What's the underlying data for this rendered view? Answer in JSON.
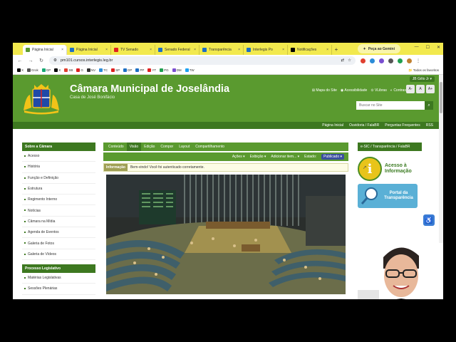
{
  "browser": {
    "tabs": [
      {
        "label": "Página Inicial",
        "color": "#5a9a2f",
        "active": true
      },
      {
        "label": "Página Inicial",
        "color": "#1d6fc4",
        "active": false
      },
      {
        "label": "TV Senado",
        "color": "#e02020",
        "active": false
      },
      {
        "label": "Senado Federal",
        "color": "#1d6fc4",
        "active": false
      },
      {
        "label": "Transparência",
        "color": "#1d6fc4",
        "active": false
      },
      {
        "label": "Interlegis Po",
        "color": "#1d6fc4",
        "active": false
      },
      {
        "label": "Notificações",
        "color": "#000000",
        "active": false
      }
    ],
    "new_tab": "+",
    "gemini_label": "Peça ao Gemini",
    "url": "pm101.cursos.interlegis.leg.br",
    "bookmarks": [
      "X",
      "Grok",
      "GP",
      "X",
      "SB",
      "G",
      "NV",
      "TC",
      "SP",
      "DP",
      "PP",
      "YT",
      "PG",
      "DM",
      "TW"
    ],
    "bookmarks_right": "Todos os favoritos"
  },
  "site": {
    "title": "Câmara Municipal de Joselândia",
    "subtitle": "Casa de José Bonifácio",
    "user": "JB Gêlo Jr ▾",
    "header_links": [
      "Mapa do Site",
      "Acessibilidade",
      "VLibras",
      "Contraste"
    ],
    "font_buttons": [
      "A-",
      "A",
      "A+"
    ],
    "search_placeholder": "Buscar no Site",
    "top_nav": [
      "Página Inicial",
      "Ouvidoria / FalaBR",
      "Perguntas Frequentes",
      "RSS"
    ]
  },
  "sidebar": {
    "section1": "Sobre a Câmara",
    "items1": [
      "Acesso",
      "História",
      "Função e Definição",
      "Estrutura",
      "Regimento Interno",
      "Notícias",
      "Câmara na Mídia",
      "Agenda de Eventos",
      "Galeria de Fotos",
      "Galeria de Vídeos"
    ],
    "section2": "Processo Legislativo",
    "items2": [
      "Matérias Legislativas",
      "Sessões Plenárias"
    ]
  },
  "editor": {
    "tabs": [
      "Conteúdo",
      "Visão",
      "Edição",
      "Compor",
      "Layout",
      "Compartilhamento"
    ],
    "active_tab": 1,
    "actions": [
      "Ações ▾",
      "Exibição ▾",
      "Adicionar item... ▾",
      "Estado:"
    ],
    "state": "Publicado ▾",
    "info_label": "Informação",
    "info_text": "Bem-vindo! Você foi autenticado corretamente."
  },
  "rightbar": {
    "heading": "e-SIC / Transparência / FalaBR",
    "acesso_line1": "Acesso à",
    "acesso_line2": "Informação",
    "portal_line1": "Portal da",
    "portal_line2": "Transparência"
  },
  "colors": {
    "brand_green": "#5a9a2f",
    "dark_green": "#3d7820",
    "tab_bar": "#f2e94e"
  }
}
